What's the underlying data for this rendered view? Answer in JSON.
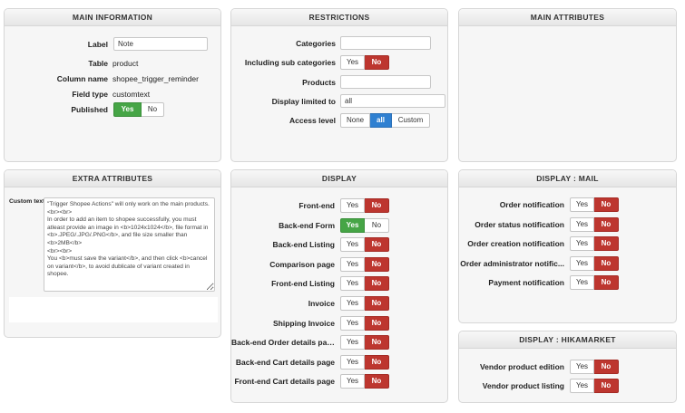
{
  "main_information": {
    "title": "MAIN INFORMATION",
    "label_label": "Label",
    "label_value": "Note",
    "table_label": "Table",
    "table_value": "product",
    "column_label": "Column name",
    "column_value": "shopee_trigger_reminder",
    "type_label": "Field type",
    "type_value": "customtext",
    "published_label": "Published",
    "yes": "Yes",
    "no": "No"
  },
  "restrictions": {
    "title": "RESTRICTIONS",
    "categories_label": "Categories",
    "categories_value": "",
    "subcat_label": "Including sub categories",
    "products_label": "Products",
    "products_value": "",
    "display_limited_label": "Display limited to",
    "display_limited_value": "all",
    "access_label": "Access level",
    "access_none": "None",
    "access_all": "all",
    "access_custom": "Custom",
    "yes": "Yes",
    "no": "No"
  },
  "main_attributes": {
    "title": "MAIN ATTRIBUTES"
  },
  "extra_attributes": {
    "title": "EXTRA ATTRIBUTES",
    "custom_text_label": "Custom text",
    "custom_text_value": "\"Trigger Shopee Actions\" will only work on the main products.\n<br><br>\nIn order to add an item to shopee successfully, you must atleast provide an image in <b>1024x1024</b>, file format in <b>.JPEG/.JPG/.PNG</b>, and file size smaller than <b>2MB</b>\n<br><br>\nYou <b>must save the variant</b>, and then click <b>cancel on variant</b>, to avoid dublicate of variant created in shopee."
  },
  "display": {
    "title": "DISPLAY",
    "yes": "Yes",
    "no": "No",
    "rows": [
      {
        "label": "Front-end",
        "state": "no"
      },
      {
        "label": "Back-end Form",
        "state": "yes"
      },
      {
        "label": "Back-end Listing",
        "state": "no"
      },
      {
        "label": "Comparison page",
        "state": "no"
      },
      {
        "label": "Front-end Listing",
        "state": "no"
      },
      {
        "label": "Invoice",
        "state": "no"
      },
      {
        "label": "Shipping Invoice",
        "state": "no"
      },
      {
        "label": "Back-end Order details page",
        "state": "no"
      },
      {
        "label": "Back-end Cart details page",
        "state": "no"
      },
      {
        "label": "Front-end Cart details page",
        "state": "no"
      }
    ]
  },
  "display_mail": {
    "title": "DISPLAY : MAIL",
    "yes": "Yes",
    "no": "No",
    "rows": [
      {
        "label": "Order notification",
        "state": "no"
      },
      {
        "label": "Order status notification",
        "state": "no"
      },
      {
        "label": "Order creation notification",
        "state": "no"
      },
      {
        "label": "Order administrator notific...",
        "state": "no"
      },
      {
        "label": "Payment notification",
        "state": "no"
      }
    ]
  },
  "display_hikamarket": {
    "title": "DISPLAY : HIKAMARKET",
    "yes": "Yes",
    "no": "No",
    "rows": [
      {
        "label": "Vendor product edition",
        "state": "no"
      },
      {
        "label": "Vendor product listing",
        "state": "no"
      }
    ]
  },
  "colors": {
    "no_active": "#bd362f",
    "yes_active": "#46a546",
    "selected_blue": "#2f80d1"
  }
}
